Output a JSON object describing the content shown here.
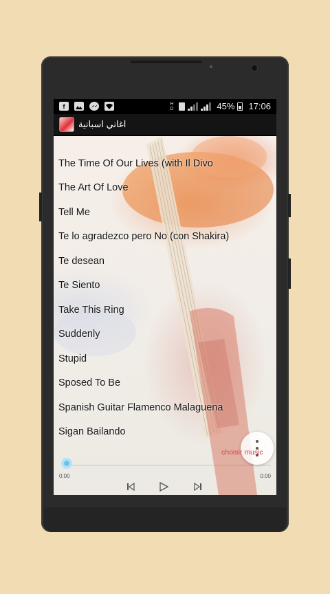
{
  "status_bar": {
    "battery": "45%",
    "time": "17:06",
    "left_icons": [
      "facebook-icon",
      "gallery-icon",
      "messenger-icon",
      "wifi-icon"
    ],
    "right_icons": [
      "hd-icon",
      "sim-icon",
      "signal-icon",
      "battery-icon"
    ]
  },
  "app_bar": {
    "title": "اغاني اسبانية",
    "icon": "app-logo-icon"
  },
  "songs": [
    "The Time Of Our Lives (with Il Divo",
    "The Art Of Love",
    "Tell Me",
    "Te lo agradezco pero No (con Shakira)",
    "Te desean",
    "Te Siento",
    "Take This Ring",
    "Suddenly",
    "Stupid",
    "Sposed To Be",
    "Spanish Guitar Flamenco Malaguena",
    "Sigan Bailando"
  ],
  "player": {
    "choose_label": "choisir music",
    "current_time": "0:00",
    "total_time": "0:00",
    "progress": 0,
    "controls": [
      "previous-icon",
      "play-icon",
      "next-icon"
    ]
  },
  "colors": {
    "page_background": "#f2dcb3",
    "accent": "#e04048",
    "seek": "#6cc3ee"
  }
}
